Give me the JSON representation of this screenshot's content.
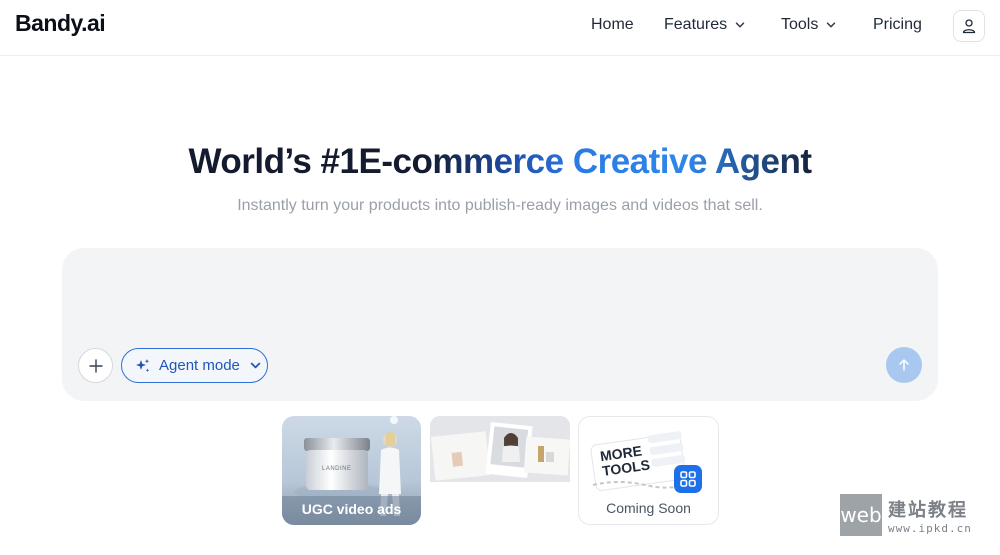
{
  "brand": {
    "name": "Bandy.ai"
  },
  "nav": {
    "home": "Home",
    "features": "Features",
    "tools": "Tools",
    "pricing": "Pricing"
  },
  "hero": {
    "title": "World’s #1E-commerce Creative Agent",
    "subtitle": "Instantly turn your products into publish-ready images and videos that sell."
  },
  "prompt": {
    "agent_mode_label": "Agent mode"
  },
  "cards": [
    {
      "label": "UGC video ads",
      "product_text": "LANDINE"
    },
    {
      "label": ""
    },
    {
      "label": "Coming Soon",
      "badge_text": "MORE TOOLS"
    }
  ],
  "watermark": {
    "box": "web",
    "cn": "建站教程",
    "url": "www.ipkd.cn"
  },
  "colors": {
    "accent": "#2f6fd8",
    "send": "#a8c8f0",
    "title_blue": "#2a7be4"
  }
}
